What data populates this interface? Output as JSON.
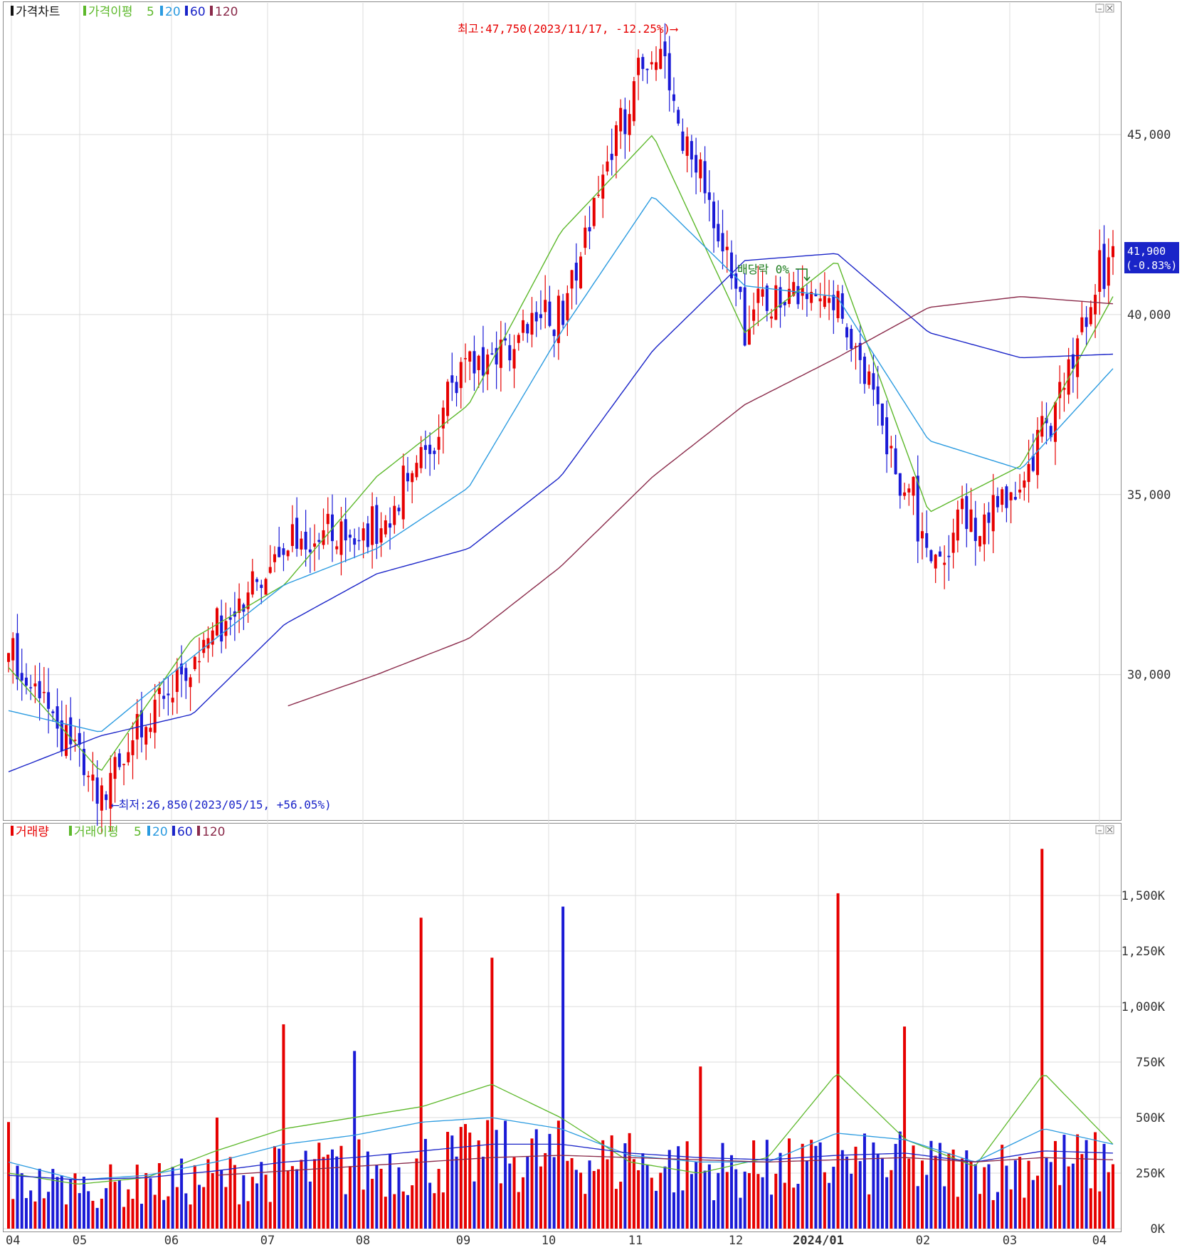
{
  "colors": {
    "up": "#e60000",
    "down": "#1a1ad6",
    "ma5": "#5cb82a",
    "ma20": "#2b9be0",
    "ma60": "#1a24c8",
    "ma120": "#8a2a4a",
    "current_box": "#1a24c8",
    "grid": "#dcdcdc",
    "frame": "#8c8c8c"
  },
  "price_panel": {
    "legend": {
      "chart": "가격차트",
      "ma_title": "가격이평",
      "ma5": "5",
      "ma20": "20",
      "ma60": "60",
      "ma120": "120"
    },
    "y_ticks": [
      "45,000",
      "40,000",
      "35,000",
      "30,000"
    ],
    "high_note": "최고:47,750(2023/11/17, -12.25%)⟶",
    "low_note": "⟵최저:26,850(2023/05/15, +56.05%)",
    "dividend_note": "배당락 0%",
    "current_price": "41,900",
    "current_change": "(-0.83%)"
  },
  "volume_panel": {
    "legend": {
      "chart": "거래량",
      "ma_title": "거래이평",
      "ma5": "5",
      "ma20": "20",
      "ma60": "60",
      "ma120": "120"
    },
    "y_ticks": [
      "1,500K",
      "1,250K",
      "1,000K",
      "750K",
      "500K",
      "250K",
      "0K"
    ]
  },
  "x_ticks": [
    "04",
    "05",
    "06",
    "07",
    "08",
    "09",
    "10",
    "11",
    "12",
    "2024/01",
    "02",
    "03",
    "04"
  ],
  "chart_data": [
    {
      "type": "line",
      "panel": "price",
      "ylim": [
        26000,
        48500
      ],
      "x": [
        "2023-04",
        "2023-05-15",
        "2023-06",
        "2023-07",
        "2023-08",
        "2023-09",
        "2023-10",
        "2023-11-17",
        "2023-12",
        "2024-01",
        "2024-02",
        "2024-03",
        "2024-04"
      ],
      "series": [
        {
          "name": "종가",
          "values": [
            30600,
            26850,
            30500,
            33500,
            34000,
            38500,
            40000,
            47750,
            40000,
            40500,
            33500,
            35000,
            41900
          ]
        },
        {
          "name": "5",
          "values": [
            30200,
            27300,
            31000,
            32500,
            35500,
            37500,
            42300,
            45000,
            39500,
            41500,
            34500,
            35800,
            40500
          ]
        },
        {
          "name": "20",
          "values": [
            29000,
            28400,
            30500,
            32500,
            33500,
            35200,
            39500,
            43300,
            40800,
            40500,
            36500,
            35700,
            38500
          ]
        },
        {
          "name": "60",
          "values": [
            27300,
            28300,
            28900,
            31400,
            32800,
            33500,
            35500,
            39000,
            41500,
            41700,
            39500,
            38800,
            38900
          ]
        },
        {
          "name": "120",
          "values": [
            null,
            null,
            null,
            29100,
            30000,
            31000,
            33000,
            35500,
            37500,
            38800,
            40200,
            40500,
            40300
          ]
        }
      ],
      "current": 41900
    },
    {
      "type": "bar",
      "panel": "volume",
      "ylim": [
        0,
        1750
      ],
      "unit": "K",
      "x": [
        "2023-04",
        "2023-05",
        "2023-06",
        "2023-07",
        "2023-07-20",
        "2023-08",
        "2023-09",
        "2023-09-15",
        "2023-10",
        "2023-11",
        "2023-12",
        "2024-01",
        "2024-02",
        "2024-02-20",
        "2024-03",
        "2024-03-20",
        "2024-04"
      ],
      "values": [
        480,
        160,
        250,
        500,
        920,
        800,
        1400,
        1220,
        1450,
        430,
        730,
        400,
        1510,
        910,
        290,
        1710,
        290
      ],
      "series": [
        {
          "name": "5",
          "values": [
            250,
            200,
            230,
            350,
            450,
            500,
            550,
            650,
            500,
            300,
            250,
            320,
            700,
            400,
            280,
            700,
            380
          ]
        },
        {
          "name": "20",
          "values": [
            300,
            220,
            240,
            300,
            380,
            420,
            480,
            500,
            450,
            330,
            300,
            300,
            430,
            400,
            300,
            450,
            380
          ]
        },
        {
          "name": "60",
          "values": [
            240,
            220,
            230,
            260,
            300,
            320,
            350,
            380,
            380,
            340,
            320,
            310,
            330,
            340,
            300,
            350,
            340
          ]
        },
        {
          "name": "120",
          "values": [
            null,
            null,
            null,
            240,
            260,
            280,
            300,
            320,
            330,
            320,
            310,
            300,
            310,
            320,
            300,
            320,
            310
          ]
        }
      ]
    }
  ]
}
